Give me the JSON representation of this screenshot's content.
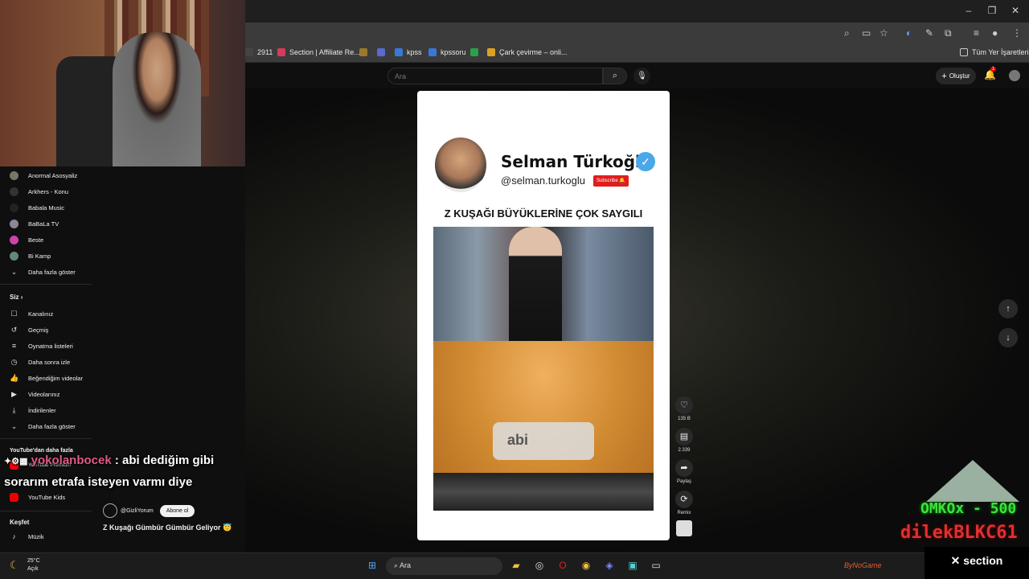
{
  "browser": {
    "bookmarks": [
      {
        "label": "2911",
        "color": "#444444"
      },
      {
        "label": "Section | Affiliate Re...",
        "color": "#d43c5a"
      },
      {
        "label": "",
        "color": "#9a7a2a"
      },
      {
        "label": "",
        "color": "#5a6ad0"
      },
      {
        "label": "kpss",
        "color": "#3a78d8"
      },
      {
        "label": "kpssoru",
        "color": "#3a78d8"
      },
      {
        "label": "",
        "color": "#2aa04a"
      },
      {
        "label": "Çark çevirme – onli...",
        "color": "#e0a020"
      }
    ],
    "all_bookmarks": "Tüm Yer İşaretleri"
  },
  "youtube": {
    "search_placeholder": "Ara",
    "create_label": "Oluştur",
    "notification_count": "1",
    "sidebar": {
      "subscriptions": [
        {
          "label": "Anormal Asosyaliz"
        },
        {
          "label": "Arkhers - Konu"
        },
        {
          "label": "Babala Music"
        },
        {
          "label": "BaBaLa TV"
        },
        {
          "label": "Beste"
        },
        {
          "label": "Bi Kamp"
        }
      ],
      "show_more_1": "Daha fazla göster",
      "you_heading": "Siz",
      "you_items": [
        {
          "label": "Kanalınız",
          "icon": "channel-icon"
        },
        {
          "label": "Geçmiş",
          "icon": "history-icon"
        },
        {
          "label": "Oynatma listeleri",
          "icon": "playlist-icon"
        },
        {
          "label": "Daha sonra izle",
          "icon": "clock-icon"
        },
        {
          "label": "Beğendiğim videolar",
          "icon": "like-icon"
        },
        {
          "label": "Videolarınız",
          "icon": "video-icon"
        },
        {
          "label": "İndirilenler",
          "icon": "download-icon"
        }
      ],
      "show_more_2": "Daha fazla göster",
      "more_heading": "YouTube'dan daha fazla",
      "more_items": [
        {
          "label": "YouTube Premium"
        },
        {
          "label": "YouTube Kids"
        }
      ],
      "explore_heading": "Keşfet",
      "explore_items": [
        {
          "label": "Müzik"
        }
      ]
    },
    "short": {
      "channel_name": "Selman Türkoğlu",
      "handle": "@selman.turkoglu",
      "subscribe_badge": "Subscribe 🔔",
      "headline": "Z KUŞAĞI BÜYÜKLERİNE ÇOK SAYGILI",
      "caption": "abi",
      "uploader": "@GizliYorum",
      "subscribe_button": "Abone ol",
      "title": "Z Kuşağı Gümbür Gümbür Geliyor 😇"
    },
    "actions": {
      "likes": "135 B",
      "comments": "2.339",
      "share": "Paylaş",
      "remix": "Remix"
    }
  },
  "stream_overlay": {
    "chat_user": "yokolanbocek",
    "chat_line1": " : abi dediğim gibi",
    "chat_line2": "sorarım etrafa isteyen varmı diye",
    "donor1": "OMKOx - 500",
    "donor2": "dilekBLKC61",
    "sponsor": "✕ section",
    "bynogame": "ByNoGame"
  },
  "taskbar": {
    "temperature": "25°C",
    "weather": "Açık",
    "search": "Ara"
  }
}
